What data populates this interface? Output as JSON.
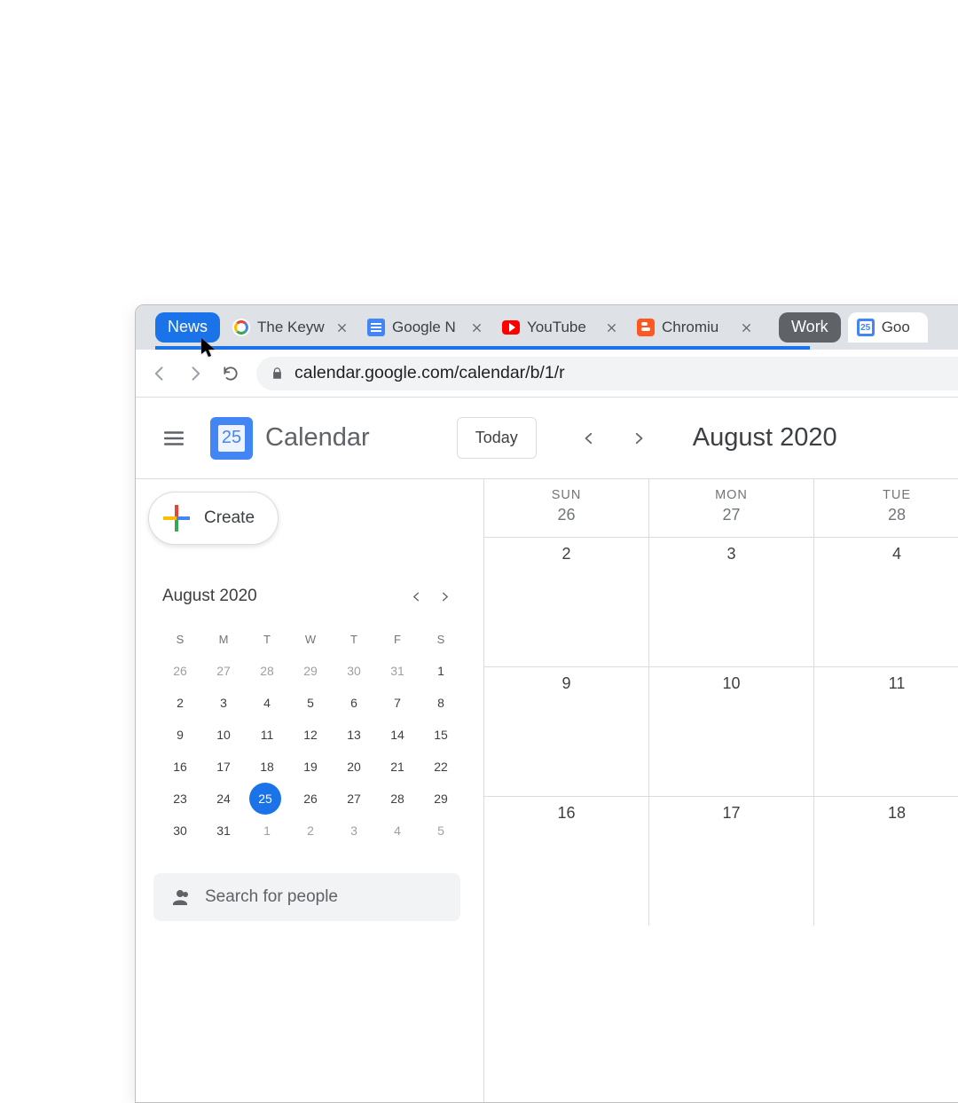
{
  "tabstrip": {
    "groups": {
      "news": "News",
      "work": "Work"
    },
    "tabs": [
      {
        "title": "The Keyw",
        "favicon": "google"
      },
      {
        "title": "Google N",
        "favicon": "gnews"
      },
      {
        "title": "YouTube",
        "favicon": "youtube"
      },
      {
        "title": "Chromiu",
        "favicon": "blogger"
      },
      {
        "title": "Goo",
        "favicon": "calendar",
        "active": true
      }
    ],
    "calendar_favicon_day": "25"
  },
  "address_bar": {
    "url": "calendar.google.com/calendar/b/1/r"
  },
  "app_header": {
    "logo_day": "25",
    "app_name": "Calendar",
    "today_label": "Today",
    "month_title": "August 2020"
  },
  "sidebar": {
    "create_label": "Create",
    "mini": {
      "title": "August 2020",
      "dow": [
        "S",
        "M",
        "T",
        "W",
        "T",
        "F",
        "S"
      ],
      "weeks": [
        [
          {
            "d": 26,
            "dim": true
          },
          {
            "d": 27,
            "dim": true
          },
          {
            "d": 28,
            "dim": true
          },
          {
            "d": 29,
            "dim": true
          },
          {
            "d": 30,
            "dim": true
          },
          {
            "d": 31,
            "dim": true
          },
          {
            "d": 1
          }
        ],
        [
          {
            "d": 2
          },
          {
            "d": 3
          },
          {
            "d": 4
          },
          {
            "d": 5
          },
          {
            "d": 6
          },
          {
            "d": 7
          },
          {
            "d": 8
          }
        ],
        [
          {
            "d": 9
          },
          {
            "d": 10
          },
          {
            "d": 11
          },
          {
            "d": 12
          },
          {
            "d": 13
          },
          {
            "d": 14
          },
          {
            "d": 15
          }
        ],
        [
          {
            "d": 16
          },
          {
            "d": 17
          },
          {
            "d": 18
          },
          {
            "d": 19
          },
          {
            "d": 20
          },
          {
            "d": 21
          },
          {
            "d": 22
          }
        ],
        [
          {
            "d": 23
          },
          {
            "d": 24
          },
          {
            "d": 25,
            "today": true
          },
          {
            "d": 26
          },
          {
            "d": 27
          },
          {
            "d": 28
          },
          {
            "d": 29
          }
        ],
        [
          {
            "d": 30
          },
          {
            "d": 31
          },
          {
            "d": 1,
            "dim": true
          },
          {
            "d": 2,
            "dim": true
          },
          {
            "d": 3,
            "dim": true
          },
          {
            "d": 4,
            "dim": true
          },
          {
            "d": 5,
            "dim": true
          }
        ]
      ]
    },
    "people_search_placeholder": "Search for people"
  },
  "main_grid": {
    "header": [
      {
        "dow": "SUN",
        "date": "26"
      },
      {
        "dow": "MON",
        "date": "27"
      },
      {
        "dow": "TUE",
        "date": "28"
      }
    ],
    "week_rows": [
      [
        "2",
        "3",
        "4"
      ],
      [
        "9",
        "10",
        "11"
      ],
      [
        "16",
        "17",
        "18"
      ]
    ]
  }
}
